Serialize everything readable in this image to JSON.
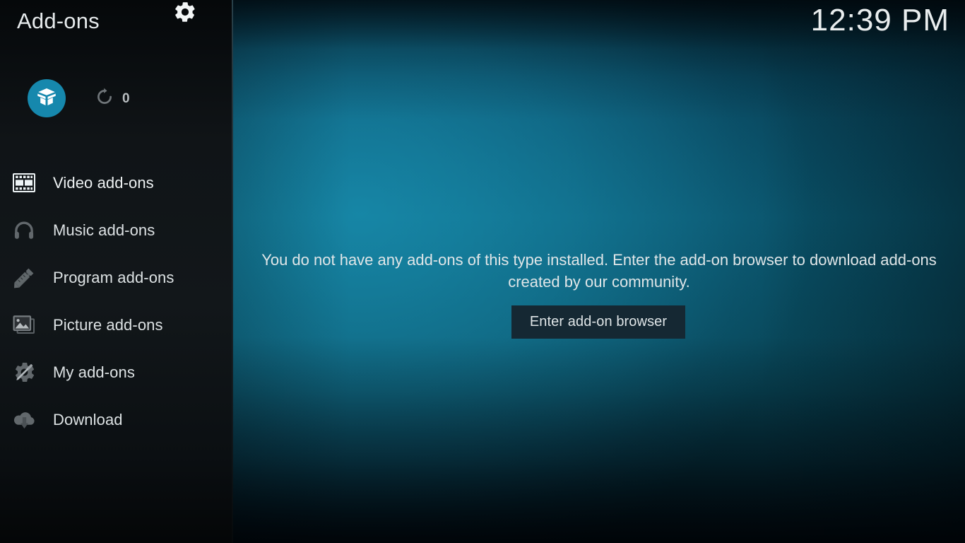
{
  "window": {
    "title": "Add-ons",
    "clock": "12:39 PM"
  },
  "colors": {
    "accent": "#1688ad",
    "sidebar_bg": "#101417",
    "content_teal": "#0e5570",
    "button_bg": "#152833",
    "text_primary": "#e0e6e8",
    "text_muted": "#b9bec1"
  },
  "header": {
    "addon_badge_icon": "open-box-icon",
    "refresh_icon": "refresh-icon",
    "refresh_count": "0",
    "settings_icon": "gear-icon"
  },
  "sidebar": {
    "items": [
      {
        "label": "Video add-ons",
        "icon": "film-strip-icon",
        "selected": true
      },
      {
        "label": "Music add-ons",
        "icon": "headphones-icon",
        "selected": false
      },
      {
        "label": "Program add-ons",
        "icon": "ruler-pencil-icon",
        "selected": false
      },
      {
        "label": "Picture add-ons",
        "icon": "photo-icon",
        "selected": false
      },
      {
        "label": "My add-ons",
        "icon": "gear-screwdriver-icon",
        "selected": false
      },
      {
        "label": "Download",
        "icon": "cloud-download-icon",
        "selected": false
      }
    ]
  },
  "main": {
    "empty_message": "You do not have any add-ons of this type installed. Enter the add-on browser to download add-ons created by our community.",
    "enter_browser_label": "Enter add-on browser"
  }
}
